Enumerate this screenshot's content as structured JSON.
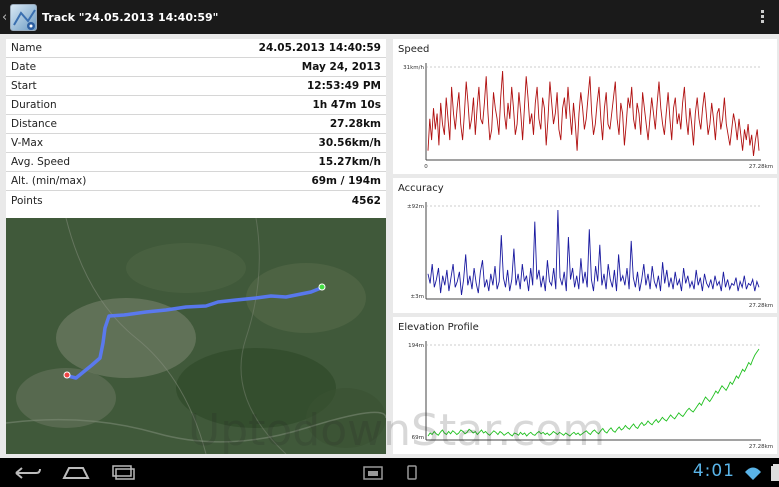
{
  "header": {
    "title": "Track \"24.05.2013 14:40:59\"",
    "app_icon": "map-app-icon",
    "overflow_icon": "overflow-menu-icon"
  },
  "details": [
    {
      "label": "Name",
      "value": "24.05.2013 14:40:59"
    },
    {
      "label": "Date",
      "value": "May 24, 2013"
    },
    {
      "label": "Start",
      "value": "12:53:49 PM"
    },
    {
      "label": "Duration",
      "value": "1h 47m 10s"
    },
    {
      "label": "Distance",
      "value": "27.28km"
    },
    {
      "label": "V-Max",
      "value": "30.56km/h"
    },
    {
      "label": "Avg. Speed",
      "value": "15.27km/h"
    },
    {
      "label": "Alt. (min/max)",
      "value": "69m / 194m"
    },
    {
      "label": "Points",
      "value": "4562"
    }
  ],
  "chart_data": [
    {
      "type": "line",
      "title": "Speed",
      "y_top_label": "31km/h",
      "x_start_label": "0",
      "x_end_label": "27.28km",
      "color": "#b01010",
      "values": [
        12,
        18,
        14,
        20,
        16,
        19,
        13,
        21,
        17,
        15,
        22,
        18,
        14,
        24,
        19,
        16,
        20,
        23,
        17,
        14,
        19,
        25,
        21,
        16,
        18,
        22,
        15,
        20,
        24,
        18,
        17,
        21,
        26,
        19,
        14,
        16,
        23,
        20,
        18,
        15,
        22,
        27,
        19,
        16,
        21,
        18,
        24,
        20,
        15,
        17,
        23,
        19,
        14,
        20,
        26,
        22,
        17,
        19,
        15,
        21,
        24,
        18,
        16,
        22,
        20,
        13,
        18,
        25,
        21,
        17,
        19,
        23,
        16,
        14,
        20,
        22,
        18,
        24,
        19,
        15,
        21,
        17,
        12,
        19,
        23,
        20,
        16,
        18,
        22,
        26,
        19,
        15,
        17,
        21,
        24,
        18,
        14,
        20,
        23,
        17,
        16,
        19,
        22,
        25,
        18,
        15,
        21,
        19,
        13,
        17,
        22,
        20,
        24,
        18,
        16,
        21,
        19,
        15,
        23,
        20,
        17,
        14,
        18,
        22,
        19,
        16,
        21,
        25,
        20,
        17,
        15,
        19,
        23,
        18,
        14,
        20,
        22,
        17,
        19,
        16,
        21,
        24,
        18,
        15,
        20,
        17,
        13,
        19,
        22,
        18,
        16,
        20,
        23,
        19,
        15,
        17,
        21,
        18,
        14,
        19,
        20,
        16,
        18,
        22,
        17,
        15,
        13,
        16,
        19,
        17,
        14,
        18,
        15,
        12,
        16,
        14,
        17,
        13,
        15,
        11,
        14,
        16,
        12
      ]
    },
    {
      "type": "line",
      "title": "Accuracy",
      "y_top_label": "±92m",
      "y_bottom_label": "±3m",
      "x_start_label": "",
      "x_end_label": "27.28km",
      "color": "#1a1aa0",
      "values": [
        25,
        20,
        30,
        18,
        22,
        28,
        15,
        24,
        19,
        27,
        16,
        23,
        30,
        18,
        21,
        26,
        14,
        22,
        35,
        19,
        24,
        17,
        28,
        20,
        15,
        26,
        32,
        18,
        22,
        16,
        25,
        19,
        29,
        17,
        21,
        45,
        23,
        18,
        27,
        16,
        22,
        38,
        19,
        25,
        17,
        30,
        21,
        24,
        16,
        28,
        19,
        52,
        22,
        27,
        18,
        24,
        16,
        32,
        21,
        19,
        28,
        17,
        58,
        23,
        19,
        26,
        16,
        44,
        22,
        28,
        18,
        24,
        17,
        33,
        20,
        26,
        18,
        48,
        22,
        16,
        29,
        21,
        40,
        19,
        25,
        17,
        30,
        22,
        18,
        27,
        16,
        35,
        21,
        24,
        19,
        28,
        17,
        42,
        23,
        18,
        26,
        16,
        22,
        30,
        19,
        25,
        17,
        29,
        21,
        18,
        24,
        16,
        31,
        20,
        27,
        18,
        23,
        17,
        26,
        19,
        22,
        16,
        28,
        20,
        24,
        18,
        21,
        17,
        27,
        19,
        23,
        16,
        25,
        20,
        18,
        22,
        17,
        24,
        19,
        21,
        16,
        26,
        18,
        22,
        17,
        20,
        19,
        23,
        16,
        21,
        18,
        24,
        17,
        20,
        19,
        22,
        16,
        21,
        18
      ]
    },
    {
      "type": "line",
      "title": "Elevation Profile",
      "y_top_label": "194m",
      "y_bottom_label": "69m",
      "x_start_label": "",
      "x_end_label": "27.28km",
      "color": "#20c020",
      "values": [
        78,
        82,
        80,
        84,
        81,
        79,
        83,
        86,
        82,
        80,
        84,
        81,
        85,
        83,
        80,
        82,
        86,
        84,
        81,
        83,
        87,
        85,
        82,
        84,
        80,
        83,
        86,
        82,
        84,
        81,
        79,
        82,
        85,
        83,
        80,
        84,
        82,
        79,
        81,
        83,
        80,
        78,
        82,
        81,
        79,
        83,
        80,
        82,
        78,
        81,
        83,
        80,
        79,
        82,
        84,
        81,
        83,
        80,
        82,
        79,
        81,
        84,
        82,
        80,
        83,
        81,
        79,
        82,
        80,
        78,
        81,
        83,
        80,
        82,
        79,
        81,
        83,
        85,
        82,
        80,
        84,
        86,
        83,
        81,
        85,
        88,
        84,
        82,
        86,
        89,
        85,
        83,
        87,
        90,
        86,
        88,
        92,
        89,
        87,
        91,
        94,
        90,
        88,
        93,
        96,
        92,
        94,
        98,
        95,
        93,
        97,
        100,
        96,
        99,
        103,
        100,
        98,
        102,
        106,
        103,
        101,
        105,
        109,
        106,
        104,
        108,
        112,
        115,
        112,
        110,
        114,
        118,
        122,
        119,
        125,
        130,
        127,
        124,
        128,
        133,
        138,
        135,
        140,
        145,
        142,
        139,
        144,
        150,
        147,
        152,
        158,
        155,
        161,
        167,
        164,
        170,
        176,
        173,
        180,
        186,
        190,
        194
      ]
    }
  ],
  "map": {
    "start_marker": "green-start-pin-icon",
    "end_marker": "red-end-pin-icon"
  },
  "navbar": {
    "back_icon": "back-icon",
    "home_icon": "home-icon",
    "recents_icon": "recents-icon",
    "time": "4:01"
  },
  "watermark": "UptodownStar.com"
}
